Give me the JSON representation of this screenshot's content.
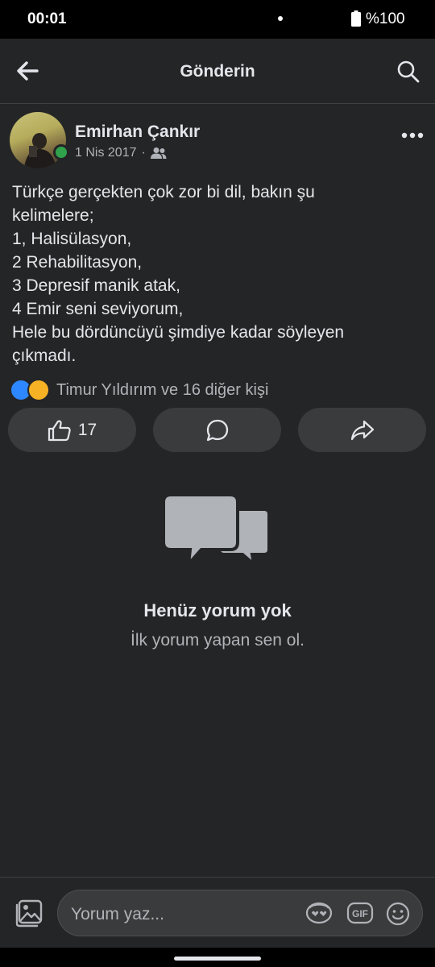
{
  "status_bar": {
    "time": "00:01",
    "battery": "%100"
  },
  "app_bar": {
    "title": "Gönderin"
  },
  "post": {
    "author": "Emirhan Çankır",
    "date": "1 Nis 2017",
    "separator": "·",
    "lines": [
      "Türkçe gerçekten çok zor bi dil, bakın şu",
      "kelimelere;",
      "1, Halisülasyon,",
      "2 Rehabilitasyon,",
      "3 Depresif manik atak,",
      "4 Emir seni seviyorum,",
      "Hele bu dördüncüyü şimdiye kadar söyleyen",
      "çıkmadı."
    ],
    "reaction_summary": "Timur Yıldırım ve 16 diğer kişi",
    "like_count": "17"
  },
  "empty_state": {
    "title": "Henüz yorum yok",
    "subtitle": "İlk yorum yapan sen ol."
  },
  "composer": {
    "placeholder": "Yorum yaz..."
  },
  "colors": {
    "background": "#242526",
    "button_bg": "#3a3b3c",
    "primary_text": "#e4e6eb",
    "secondary_text": "#b0b3b8",
    "online": "#31a24c"
  }
}
